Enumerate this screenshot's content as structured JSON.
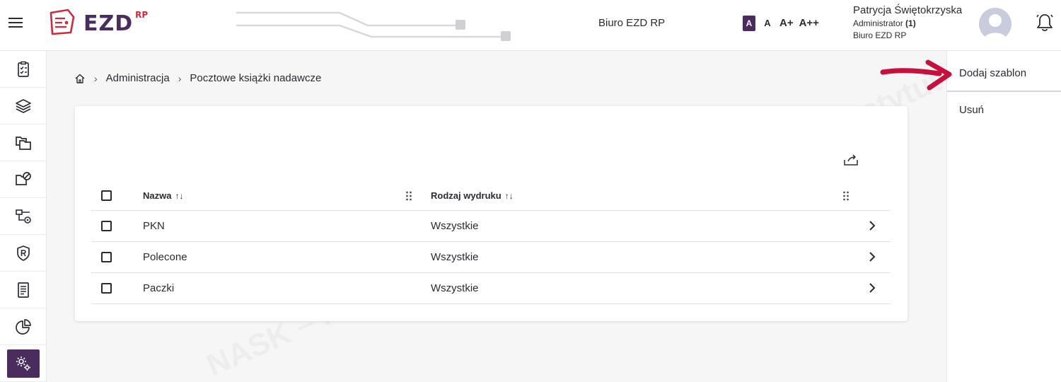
{
  "header": {
    "logo_text": "EZD",
    "logo_sup": "RP",
    "office_name": "Biuro EZD RP",
    "font_sizes": [
      "A",
      "A",
      "A+",
      "A++"
    ],
    "user": {
      "name": "Patrycja Świętokrzyska",
      "role": "Administrator",
      "role_count": "(1)",
      "office": "Biuro EZD RP"
    }
  },
  "sidebar": {
    "items": [
      {
        "icon": "clipboard-checklist-icon",
        "active": false
      },
      {
        "icon": "layers-icon",
        "active": false
      },
      {
        "icon": "folders-icon",
        "active": false
      },
      {
        "icon": "folder-blocked-icon",
        "active": false
      },
      {
        "icon": "flow-settings-icon",
        "active": false
      },
      {
        "icon": "shield-r-icon",
        "active": false
      },
      {
        "icon": "document-list-icon",
        "active": false
      },
      {
        "icon": "pie-chart-icon",
        "active": false
      },
      {
        "icon": "gears-icon",
        "active": true
      }
    ]
  },
  "breadcrumb": {
    "home_icon": "home-icon",
    "items": [
      "Administracja",
      "Pocztowe książki nadawcze"
    ]
  },
  "table": {
    "columns": [
      "Nazwa",
      "Rodzaj wydruku"
    ],
    "rows": [
      {
        "name": "PKN",
        "type": "Wszystkie"
      },
      {
        "name": "Polecone",
        "type": "Wszystkie"
      },
      {
        "name": "Paczki",
        "type": "Wszystkie"
      }
    ]
  },
  "actions": {
    "add_template": "Dodaj szablon",
    "delete": "Usuń"
  },
  "watermark": {
    "text": "NASK – Państwowy Instytut Badawczy"
  },
  "colors": {
    "brand": "#4a2c5e",
    "accent_red": "#d02a3d",
    "arrow": "#c8103c"
  }
}
